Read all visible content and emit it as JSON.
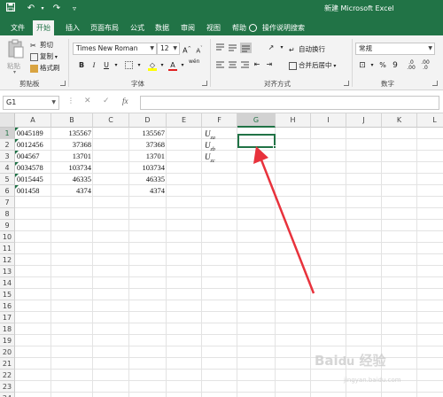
{
  "window": {
    "title": "新建 Microsoft Excel"
  },
  "quick_access": {
    "save_icon": "save-icon",
    "undo_icon": "undo-icon",
    "redo_icon": "redo-icon",
    "customize_icon": "customize-qat-icon"
  },
  "tabs": [
    {
      "label": "文件"
    },
    {
      "label": "开始"
    },
    {
      "label": "插入"
    },
    {
      "label": "页面布局"
    },
    {
      "label": "公式"
    },
    {
      "label": "数据"
    },
    {
      "label": "审阅"
    },
    {
      "label": "视图"
    },
    {
      "label": "帮助"
    }
  ],
  "tell_me": "操作说明搜索",
  "ribbon": {
    "clipboard": {
      "paste": "粘贴",
      "cut": "剪切",
      "copy": "复制",
      "format_painter": "格式刷",
      "group": "剪贴板"
    },
    "font": {
      "family": "Times New Roman",
      "size": "12",
      "bold": "B",
      "italic": "I",
      "underline": "U",
      "grow": "A",
      "shrink": "A",
      "group": "字体",
      "phonetic": "wén"
    },
    "alignment": {
      "wrap": "自动换行",
      "merge": "合并后居中",
      "group": "对齐方式"
    },
    "number": {
      "format": "常规",
      "percent": "%",
      "comma": "9",
      "group": "数字"
    }
  },
  "formula_bar": {
    "name_box": "G1",
    "fx": "fx",
    "cancel": "✕",
    "enter": "✓",
    "value": ""
  },
  "columns": [
    "A",
    "B",
    "C",
    "D",
    "E",
    "F",
    "G",
    "H",
    "I",
    "J",
    "K",
    "L"
  ],
  "rows": [
    "1",
    "2",
    "3",
    "4",
    "5",
    "6",
    "7",
    "8",
    "9",
    "10",
    "11",
    "12",
    "13",
    "14",
    "15",
    "16",
    "17",
    "18",
    "19",
    "20",
    "21",
    "22",
    "23",
    "24"
  ],
  "cells": {
    "A": [
      "0045189",
      "0012456",
      "004567",
      "0034578",
      "0015445",
      "001458"
    ],
    "B": [
      "135567",
      "37368",
      "13701",
      "103734",
      "46335",
      "4374"
    ],
    "D": [
      "135567",
      "37368",
      "13701",
      "103734",
      "46335",
      "4374"
    ],
    "F": [
      {
        "base": "U",
        "sub": "za"
      },
      {
        "base": "U",
        "sub": "zb"
      },
      {
        "base": "U",
        "sub": "zc"
      }
    ]
  },
  "selected_cell": "G1",
  "colors": {
    "accent": "#217346",
    "arrow": "#e8323c"
  }
}
